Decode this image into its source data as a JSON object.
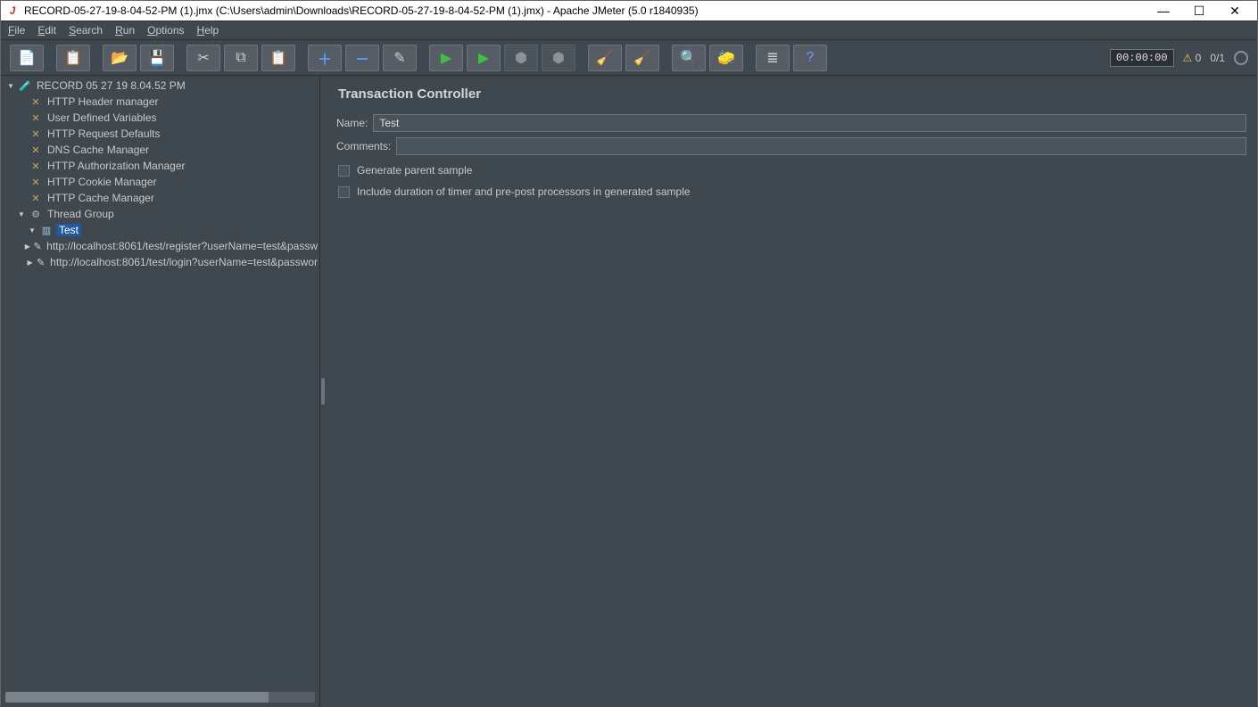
{
  "window": {
    "title": "RECORD-05-27-19-8-04-52-PM (1).jmx (C:\\Users\\admin\\Downloads\\RECORD-05-27-19-8-04-52-PM (1).jmx) - Apache JMeter (5.0 r1840935)"
  },
  "menu": {
    "file": "File",
    "edit": "Edit",
    "search": "Search",
    "run": "Run",
    "options": "Options",
    "help": "Help"
  },
  "status": {
    "timer": "00:00:00",
    "warning_count": "0",
    "threads": "0/1"
  },
  "tree": {
    "root": "RECORD 05 27 19 8.04.52 PM",
    "items": [
      "HTTP Header manager",
      "User Defined Variables",
      "HTTP Request Defaults",
      "DNS Cache Manager",
      "HTTP Authorization Manager",
      "HTTP Cookie Manager",
      "HTTP Cache Manager"
    ],
    "thread_group": "Thread Group",
    "test_node": "Test",
    "samplers": [
      "http://localhost:8061/test/register?userName=test&passw",
      "http://localhost:8061/test/login?userName=test&passwor"
    ]
  },
  "panel": {
    "title": "Transaction Controller",
    "name_label": "Name:",
    "name_value": "Test",
    "comments_label": "Comments:",
    "cb1": "Generate parent sample",
    "cb2": "Include duration of timer and pre-post processors in generated sample"
  }
}
